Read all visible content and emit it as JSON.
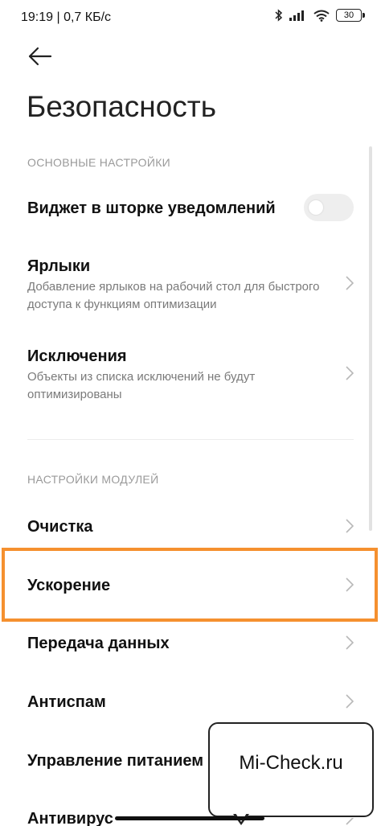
{
  "status": {
    "time_speed": "19:19 | 0,7 КБ/с",
    "battery": "30"
  },
  "header": {
    "title": "Безопасность"
  },
  "sections": [
    {
      "label": "ОСНОВНЫЕ НАСТРОЙКИ"
    },
    {
      "label": "НАСТРОЙКИ МОДУЛЕЙ"
    }
  ],
  "items": [
    {
      "title": "Виджет в шторке уведомлений",
      "toggle_on": false
    },
    {
      "title": "Ярлыки",
      "subtitle": "Добавление ярлыков на рабочий стол для быстрого доступа к функциям оптимизации"
    },
    {
      "title": "Исключения",
      "subtitle": "Объекты из списка исключений не будут оптимизированы"
    },
    {
      "title": "Очистка"
    },
    {
      "title": "Ускорение"
    },
    {
      "title": "Передача данных"
    },
    {
      "title": "Антиспам"
    },
    {
      "title": "Управление питанием"
    },
    {
      "title": "Антивирус"
    }
  ],
  "watermark": {
    "text": "Mi-Check.ru"
  },
  "colors": {
    "highlight": "#f5902f",
    "section_text": "#9a9a9a"
  }
}
